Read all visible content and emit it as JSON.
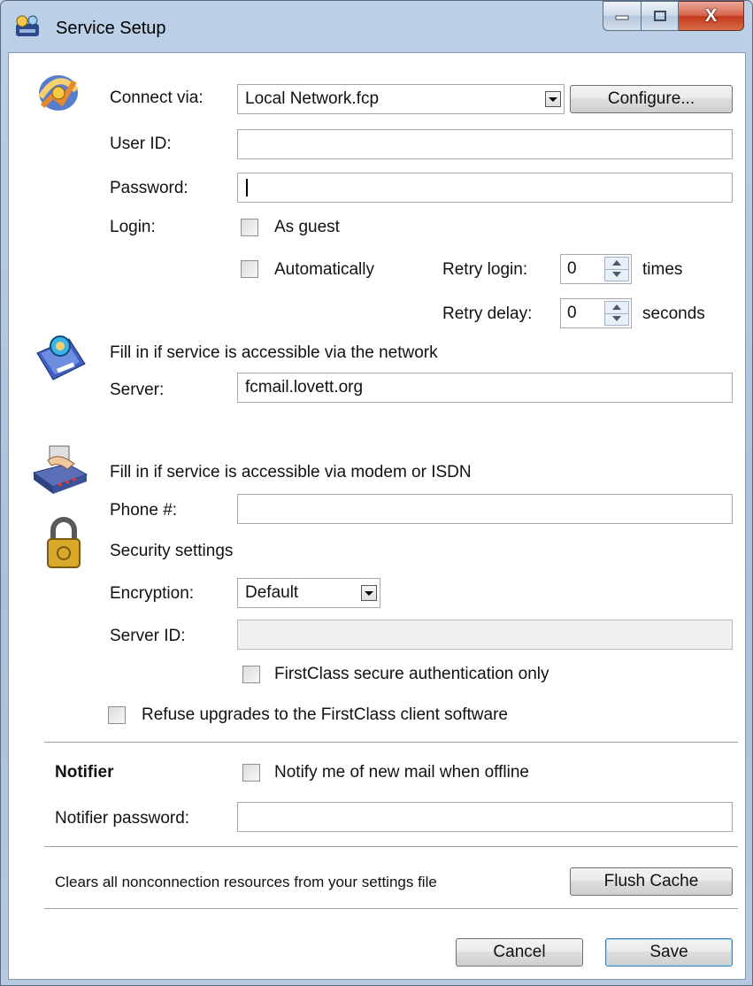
{
  "window": {
    "title": "Service Setup",
    "close_glyph": "X"
  },
  "connect": {
    "label": "Connect via:",
    "value": "Local Network.fcp",
    "configure_label": "Configure..."
  },
  "user_id": {
    "label": "User ID:",
    "value": ""
  },
  "password": {
    "label": "Password:",
    "value": ""
  },
  "login": {
    "label": "Login:",
    "as_guest_label": "As guest",
    "automatically_label": "Automatically",
    "retry_login_label": "Retry login:",
    "retry_login_value": "0",
    "retry_login_unit": "times",
    "retry_delay_label": "Retry delay:",
    "retry_delay_value": "0",
    "retry_delay_unit": "seconds"
  },
  "network": {
    "heading": "Fill in if service is accessible via the network",
    "server_label": "Server:",
    "server_value": "fcmail.lovett.org"
  },
  "modem": {
    "heading": "Fill in if service is accessible via modem or ISDN",
    "phone_label": "Phone #:",
    "phone_value": ""
  },
  "security": {
    "heading": "Security settings",
    "encryption_label": "Encryption:",
    "encryption_value": "Default",
    "server_id_label": "Server ID:",
    "server_id_value": "",
    "secure_auth_label": "FirstClass secure authentication only",
    "refuse_upgrades_label": "Refuse upgrades to the FirstClass client software"
  },
  "notifier": {
    "heading": "Notifier",
    "notify_label": "Notify me of new mail when offline",
    "password_label": "Notifier password:",
    "password_value": ""
  },
  "cache": {
    "description": "Clears all nonconnection resources from your settings file",
    "flush_label": "Flush Cache"
  },
  "footer": {
    "cancel_label": "Cancel",
    "save_label": "Save"
  },
  "colors": {
    "titlebar": "#b6cbe2",
    "close_button": "#c9442a",
    "default_button_border": "#3c7fb1"
  },
  "icons": [
    "app-icon",
    "connection-icon",
    "network-server-icon",
    "modem-icon",
    "padlock-icon"
  ]
}
